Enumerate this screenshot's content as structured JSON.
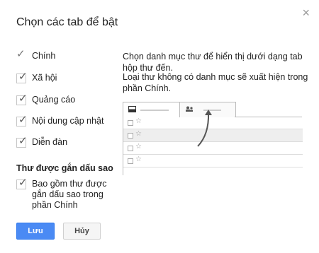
{
  "dialog": {
    "title": "Chọn các tab để bật",
    "close_glyph": "×"
  },
  "tabs": [
    {
      "label": "Chính",
      "checked": true
    },
    {
      "label": "Xã hội",
      "checked": true
    },
    {
      "label": "Quảng cáo",
      "checked": true
    },
    {
      "label": "Nội dung cập nhật",
      "checked": true
    },
    {
      "label": "Diễn đàn",
      "checked": true
    }
  ],
  "starred": {
    "heading": "Thư được gắn dấu sao",
    "option_label": "Bao gồm thư được gắn dấu sao trong phần Chính",
    "checked": true
  },
  "description": {
    "line1": "Chọn danh mục thư để hiển thị dưới dạng tab hộp thư đến.",
    "line2": "Loại thư không có danh mục sẽ xuất hiện trong phần Chính."
  },
  "illustration": {
    "inbox_icon": "inbox-icon",
    "people_icon": "people-icon"
  },
  "buttons": {
    "save": "Lưu",
    "cancel": "Hủy"
  },
  "colors": {
    "primary": "#4a8af4",
    "primary_border": "#3079ed"
  }
}
